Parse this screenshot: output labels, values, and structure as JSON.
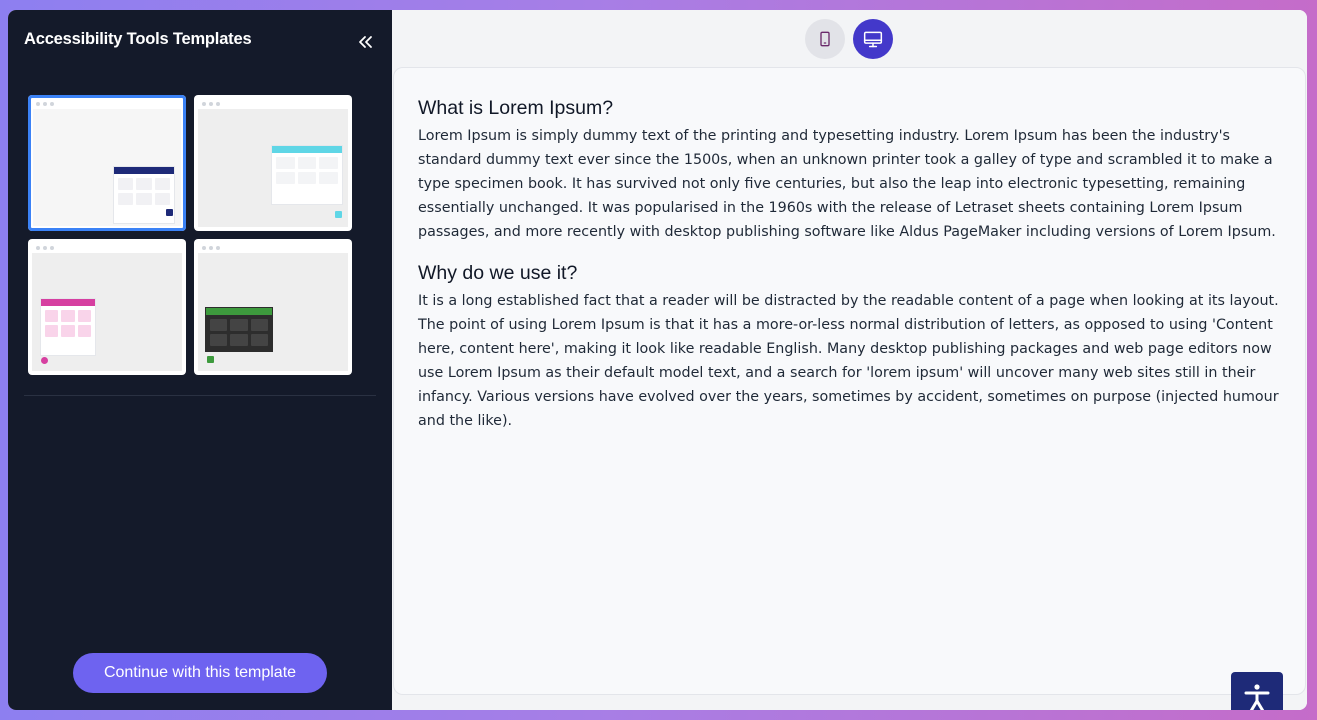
{
  "sidebar": {
    "title": "Accessibility Tools Templates",
    "collapse_icon": "chevrons-left-icon",
    "templates": [
      {
        "name": "dark-navy",
        "accent": "#1e2a78",
        "selected": true
      },
      {
        "name": "cyan",
        "accent": "#5fd6e6",
        "selected": false
      },
      {
        "name": "pink",
        "accent": "#d63fa0",
        "selected": false
      },
      {
        "name": "green-dark",
        "accent": "#3d9a3d",
        "selected": false
      }
    ],
    "continue_label": "Continue with this template"
  },
  "toolbar": {
    "mobile_icon": "smartphone-icon",
    "desktop_icon": "monitor-icon",
    "active_view": "desktop"
  },
  "preview": {
    "section1": {
      "heading": "What is Lorem Ipsum?",
      "body": "Lorem Ipsum is simply dummy text of the printing and typesetting industry. Lorem Ipsum has been the industry's standard dummy text ever since the 1500s, when an unknown printer took a galley of type and scrambled it to make a type specimen book. It has survived not only five centuries, but also the leap into electronic typesetting, remaining essentially unchanged. It was popularised in the 1960s with the release of Letraset sheets containing Lorem Ipsum passages, and more recently with desktop publishing software like Aldus PageMaker including versions of Lorem Ipsum."
    },
    "section2": {
      "heading": "Why do we use it?",
      "body": "It is a long established fact that a reader will be distracted by the readable content of a page when looking at its layout. The point of using Lorem Ipsum is that it has a more-or-less normal distribution of letters, as opposed to using 'Content here, content here', making it look like readable English. Many desktop publishing packages and web page editors now use Lorem Ipsum as their default model text, and a search for 'lorem ipsum' will uncover many web sites still in their infancy. Various versions have evolved over the years, sometimes by accident, sometimes on purpose (injected humour and the like)."
    },
    "fab_icon": "accessibility-icon",
    "fab_color": "#1e2a78"
  },
  "colors": {
    "sidebar_bg": "#141a2a",
    "primary_button": "#6e63f0",
    "active_toggle": "#4338ca",
    "selected_outline": "#3b82f6"
  }
}
